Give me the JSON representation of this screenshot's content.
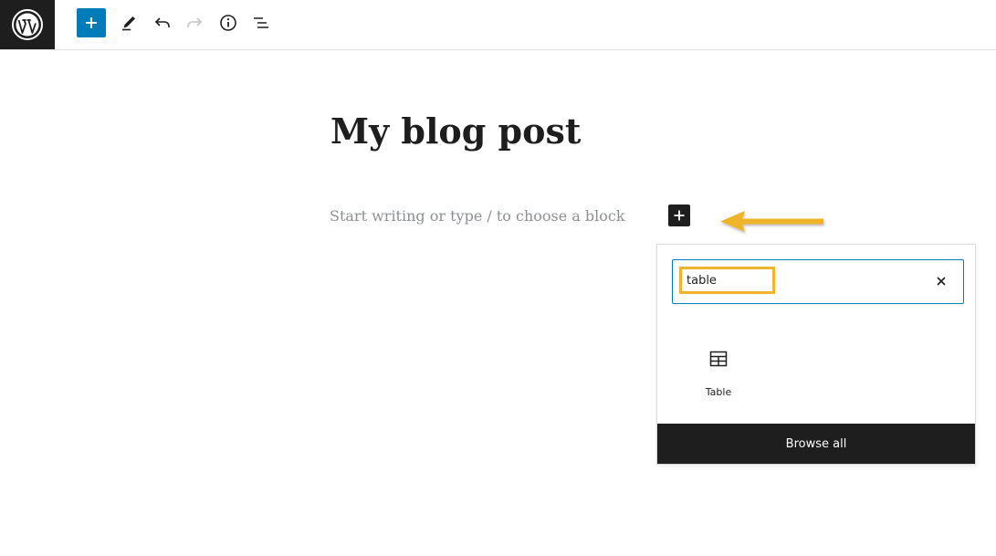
{
  "toolbar": {
    "logo_icon": "wordpress-logo",
    "add_block_icon": "plus-icon",
    "tools_icon": "pencil-icon",
    "undo_icon": "undo-icon",
    "redo_icon": "redo-icon",
    "details_icon": "info-icon",
    "list_view_icon": "list-view-icon",
    "accent_color": "#007cba"
  },
  "editor": {
    "title": "My blog post",
    "placeholder": "Start writing or type / to choose a block",
    "inline_inserter_icon": "plus-icon"
  },
  "annotation": {
    "arrow_color": "#f0b429",
    "highlight_color": "#f0b429"
  },
  "inserter": {
    "search": {
      "value": "table",
      "clear_icon": "close-icon"
    },
    "results": [
      {
        "label": "Table",
        "icon": "table-icon"
      }
    ],
    "browse_all_label": "Browse all"
  }
}
